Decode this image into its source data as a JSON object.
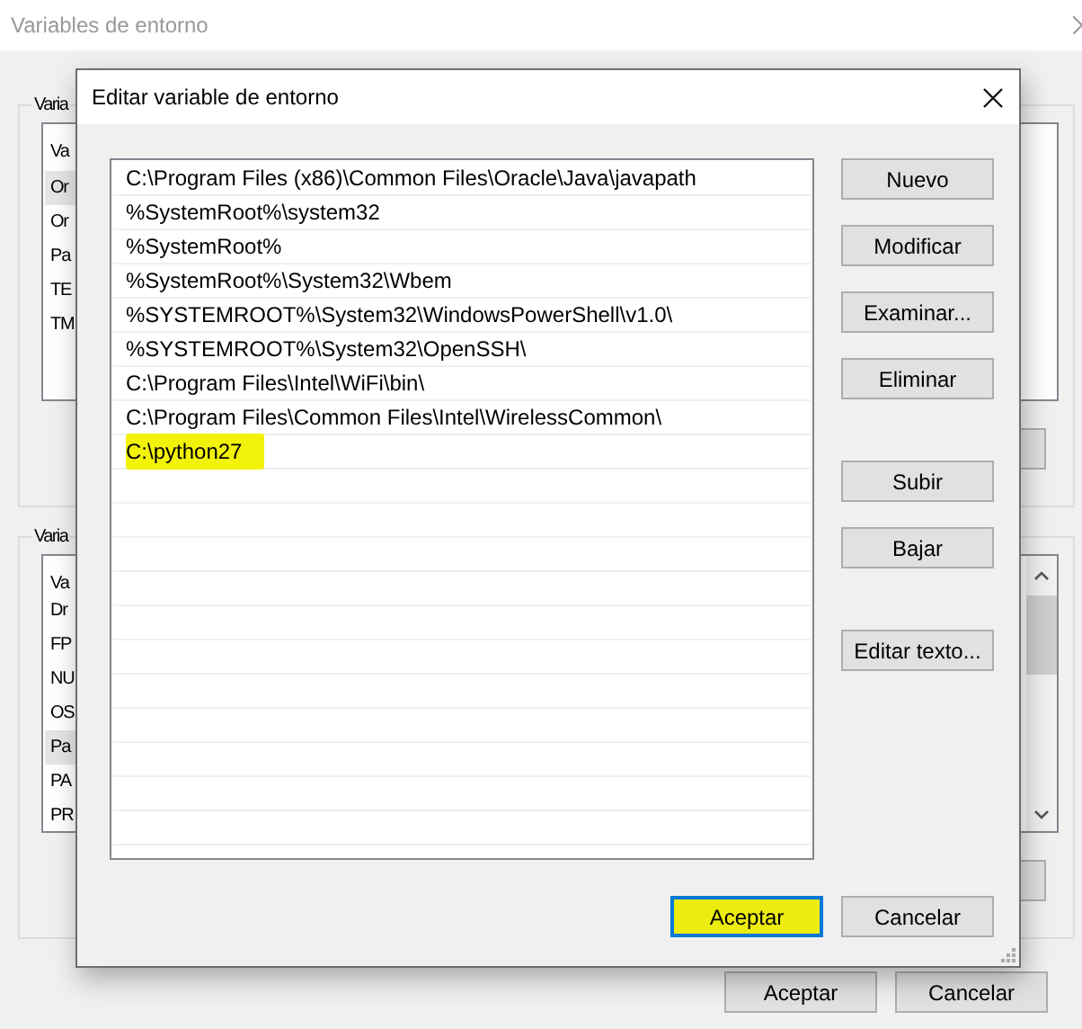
{
  "background_window": {
    "title": "Variables de entorno",
    "groups": [
      {
        "label": "Varia",
        "header": "Va",
        "rows": [
          {
            "text": "Or",
            "selected": true
          },
          {
            "text": "Or",
            "selected": false
          },
          {
            "text": "Pa",
            "selected": false
          },
          {
            "text": "TE",
            "selected": false
          },
          {
            "text": "TM",
            "selected": false
          }
        ]
      },
      {
        "label": "Varia",
        "header": "Va",
        "rows": [
          {
            "text": "Dr",
            "selected": false
          },
          {
            "text": "FP",
            "selected": false
          },
          {
            "text": "NU",
            "selected": false
          },
          {
            "text": "OS",
            "selected": false
          },
          {
            "text": "Pa",
            "selected": true
          },
          {
            "text": "PA",
            "selected": false
          },
          {
            "text": "PR",
            "selected": false
          }
        ]
      }
    ],
    "buttons": [
      "Aceptar",
      "Cancelar"
    ]
  },
  "dialog": {
    "title": "Editar variable de entorno",
    "entries": [
      {
        "text": "C:\\Program Files (x86)\\Common Files\\Oracle\\Java\\javapath",
        "highlighted": false
      },
      {
        "text": "%SystemRoot%\\system32",
        "highlighted": false
      },
      {
        "text": "%SystemRoot%",
        "highlighted": false
      },
      {
        "text": "%SystemRoot%\\System32\\Wbem",
        "highlighted": false
      },
      {
        "text": "%SYSTEMROOT%\\System32\\WindowsPowerShell\\v1.0\\",
        "highlighted": false
      },
      {
        "text": "%SYSTEMROOT%\\System32\\OpenSSH\\",
        "highlighted": false
      },
      {
        "text": "C:\\Program Files\\Intel\\WiFi\\bin\\",
        "highlighted": false
      },
      {
        "text": "C:\\Program Files\\Common Files\\Intel\\WirelessCommon\\",
        "highlighted": false
      },
      {
        "text": "C:\\python27",
        "highlighted": true
      }
    ],
    "side_buttons": [
      "Nuevo",
      "Modificar",
      "Examinar...",
      "Eliminar",
      "Subir",
      "Bajar",
      "Editar texto..."
    ],
    "buttons": [
      {
        "label": "Aceptar",
        "focused": true,
        "highlighted": true
      },
      {
        "label": "Cancelar",
        "focused": false,
        "highlighted": false
      }
    ]
  }
}
